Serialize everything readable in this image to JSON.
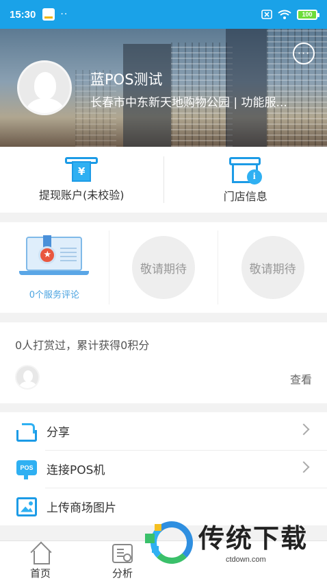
{
  "status_bar": {
    "time": "15:30",
    "dots": "··",
    "battery": "100",
    "icons": [
      "app-notification-icon",
      "no-sim-icon",
      "wifi-icon",
      "battery-icon"
    ]
  },
  "profile": {
    "name": "蓝POS测试",
    "subtitle": "长春市中东新天地购物公园 | 功能服...",
    "message_button": "···"
  },
  "quick_entries": [
    {
      "label": "提现账户(未校验)",
      "icon": "withdraw-account-icon",
      "glyph": "¥"
    },
    {
      "label": "门店信息",
      "icon": "store-info-icon",
      "glyph": "i"
    }
  ],
  "badges": {
    "service_comments": "0个服务评论",
    "placeholder_1": "敬请期待",
    "placeholder_2": "敬请期待"
  },
  "rewards": {
    "summary": "0人打赏过，累计获得0积分",
    "view_link": "查看"
  },
  "menu": [
    {
      "label": "分享",
      "icon": "share-icon",
      "has_chevron": true
    },
    {
      "label": "连接POS机",
      "icon": "pos-icon",
      "icon_text": "POS",
      "has_chevron": true
    },
    {
      "label": "上传商场图片",
      "icon": "image-upload-icon",
      "has_chevron": false
    }
  ],
  "tabs": [
    {
      "label": "首页",
      "icon": "home-icon"
    },
    {
      "label": "分析",
      "icon": "analysis-icon"
    }
  ],
  "watermark": {
    "title": "传统下载",
    "url": "ctdown.com"
  },
  "colors": {
    "accent": "#1aa2e8",
    "icon_blue": "#2fb0f2",
    "link_blue": "#4aa3e0"
  }
}
